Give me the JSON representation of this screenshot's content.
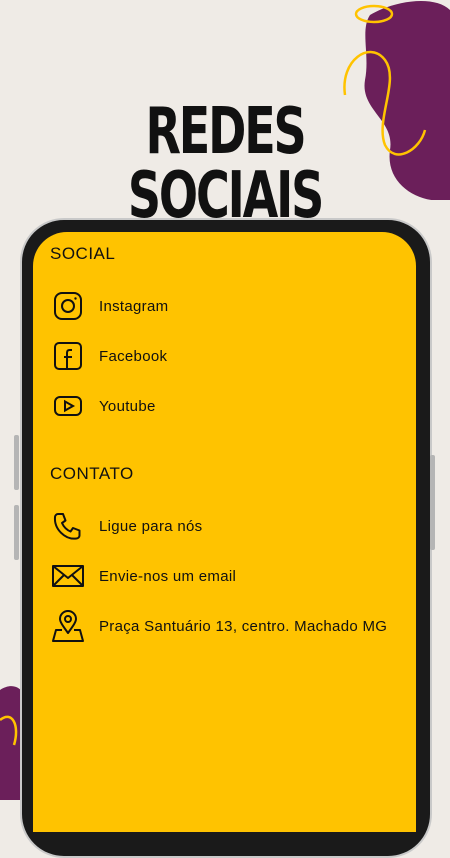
{
  "headline": "REDES SOCIAIS",
  "colors": {
    "background": "#efebe6",
    "screen": "#ffc300",
    "accent_purple": "#6b1f5a",
    "accent_yellow": "#ffc300"
  },
  "social": {
    "title": "SOCIAL",
    "items": [
      {
        "label": "Instagram",
        "icon": "instagram-icon"
      },
      {
        "label": "Facebook",
        "icon": "facebook-icon"
      },
      {
        "label": "Youtube",
        "icon": "youtube-icon"
      }
    ]
  },
  "contact": {
    "title": "CONTATO",
    "items": [
      {
        "label": "Ligue para nós",
        "icon": "phone-icon"
      },
      {
        "label": "Envie-nos um email",
        "icon": "mail-icon"
      },
      {
        "label": "Praça Santuário 13, centro. Machado MG",
        "icon": "map-pin-icon"
      }
    ]
  }
}
